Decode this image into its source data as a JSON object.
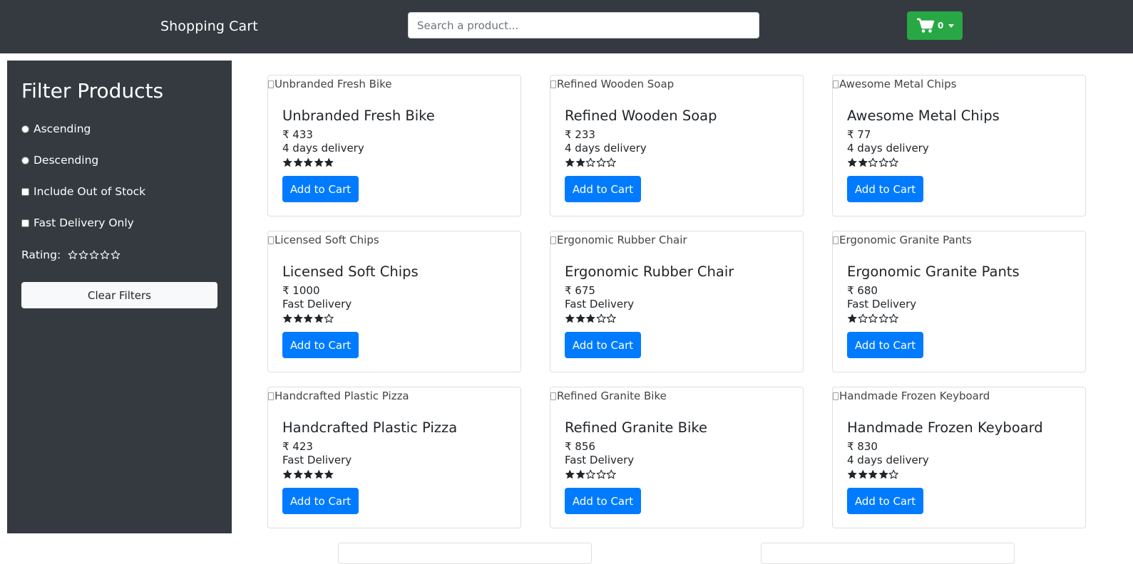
{
  "header": {
    "brand": "Shopping Cart",
    "search_placeholder": "Search a product...",
    "cart_count": "0",
    "cart_color": "#28a745"
  },
  "sidebar": {
    "title": "Filter Products",
    "sort_options": [
      "Ascending",
      "Descending"
    ],
    "checkbox_options": [
      "Include Out of Stock",
      "Fast Delivery Only"
    ],
    "rating_label": "Rating:",
    "rating_value": 0,
    "clear_label": "Clear Filters"
  },
  "products": [
    {
      "name": "Unbranded Fresh Bike",
      "price": "₹ 433",
      "delivery": "4 days delivery",
      "rating": 5,
      "button": "Add to Cart"
    },
    {
      "name": "Refined Wooden Soap",
      "price": "₹ 233",
      "delivery": "4 days delivery",
      "rating": 2,
      "button": "Add to Cart"
    },
    {
      "name": "Awesome Metal Chips",
      "price": "₹ 77",
      "delivery": "4 days delivery",
      "rating": 2,
      "button": "Add to Cart"
    },
    {
      "name": "Licensed Soft Chips",
      "price": "₹ 1000",
      "delivery": "Fast Delivery",
      "rating": 4,
      "button": "Add to Cart"
    },
    {
      "name": "Ergonomic Rubber Chair",
      "price": "₹ 675",
      "delivery": "Fast Delivery",
      "rating": 3,
      "button": "Add to Cart"
    },
    {
      "name": "Ergonomic Granite Pants",
      "price": "₹ 680",
      "delivery": "Fast Delivery",
      "rating": 1,
      "button": "Add to Cart"
    },
    {
      "name": "Handcrafted Plastic Pizza",
      "price": "₹ 423",
      "delivery": "Fast Delivery",
      "rating": 5,
      "button": "Add to Cart"
    },
    {
      "name": "Refined Granite Bike",
      "price": "₹ 856",
      "delivery": "Fast Delivery",
      "rating": 2,
      "button": "Add to Cart"
    },
    {
      "name": "Handmade Frozen Keyboard",
      "price": "₹ 830",
      "delivery": "4 days delivery",
      "rating": 4,
      "button": "Add to Cart"
    }
  ],
  "colors": {
    "navbar": "#343a40",
    "primary_button": "#007bff",
    "success_button": "#28a745"
  }
}
